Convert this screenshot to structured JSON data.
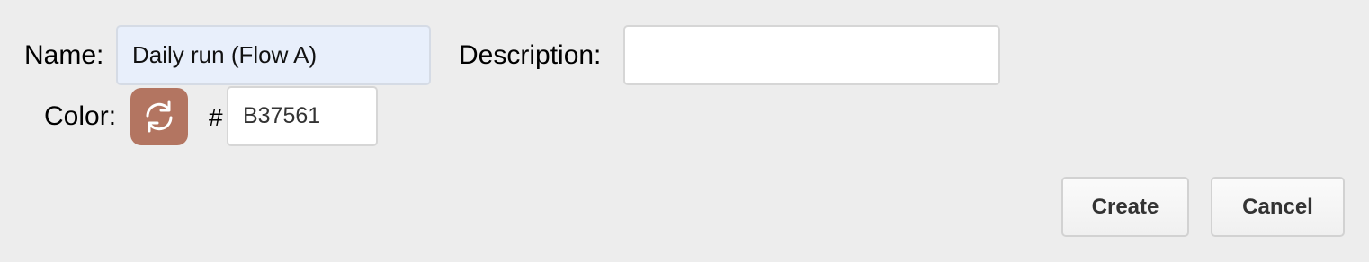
{
  "form": {
    "name_label": "Name:",
    "name_value": "Daily run (Flow A)",
    "description_label": "Description:",
    "description_value": "",
    "color_label": "Color:",
    "hash_label": "#",
    "color_hex_value": "B37561",
    "swatch_color": "#B37561",
    "swatch_icon": "refresh-icon"
  },
  "buttons": {
    "create_label": "Create",
    "cancel_label": "Cancel"
  }
}
